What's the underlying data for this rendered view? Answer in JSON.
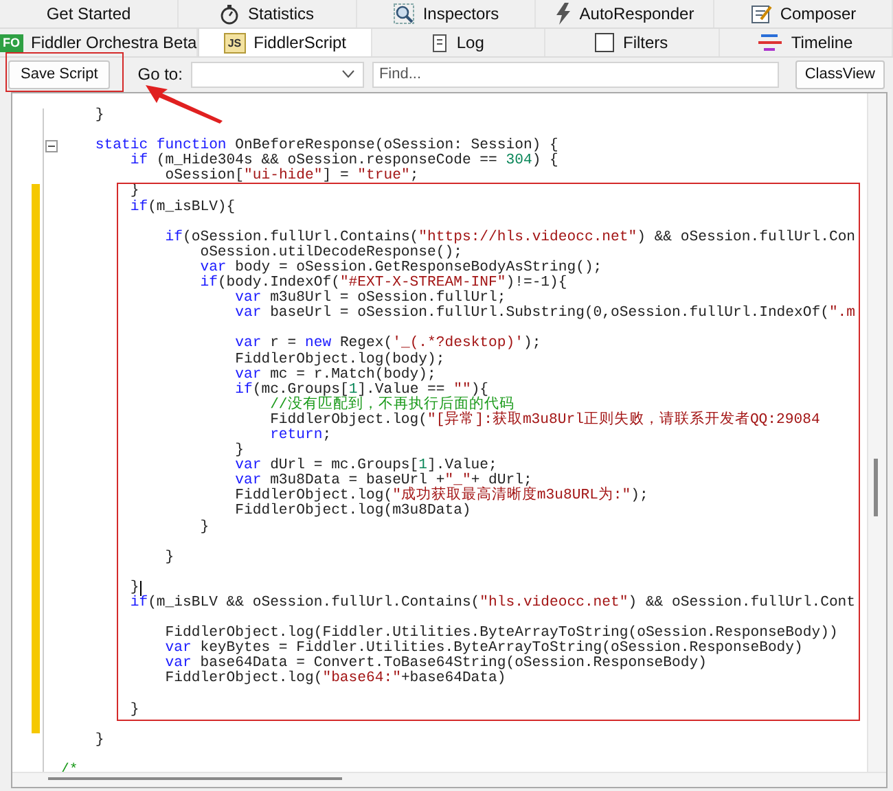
{
  "tabs": [
    [
      {
        "label": "Get Started",
        "selected": false
      },
      {
        "label": "Statistics",
        "selected": false
      },
      {
        "label": "Inspectors",
        "selected": false
      },
      {
        "label": "AutoResponder",
        "selected": false
      },
      {
        "label": "Composer",
        "selected": false
      }
    ],
    [
      {
        "label": "Fiddler Orchestra Beta",
        "badge": "FO",
        "selected": false
      },
      {
        "label": "FiddlerScript",
        "badge": "JS",
        "selected": true
      },
      {
        "label": "Log",
        "selected": false
      },
      {
        "label": "Filters",
        "selected": false
      },
      {
        "label": "Timeline",
        "selected": false
      }
    ]
  ],
  "toolbar": {
    "save_button": "Save Script",
    "goto_label": "Go to:",
    "find_field": {
      "placeholder": "Find..."
    },
    "classview_button": "ClassView"
  },
  "editor": {
    "lines": [
      {
        "changed": false,
        "fold": false,
        "caret": false,
        "parts": [
          {
            "kind": "plain",
            "text": "    }"
          }
        ]
      },
      {
        "changed": false,
        "fold": false,
        "caret": false
      },
      {
        "changed": false,
        "fold": true,
        "caret": false,
        "parts": [
          {
            "kind": "keyword",
            "text": "    static"
          },
          {
            "kind": "keyword",
            "text": " function"
          },
          {
            "kind": "plain",
            "text": " OnBeforeResponse(oSession: Session) {"
          }
        ]
      },
      {
        "changed": false,
        "fold": false,
        "caret": false,
        "parts": [
          {
            "kind": "keyword",
            "text": "        if"
          },
          {
            "kind": "plain",
            "text": " (m_Hide304s && oSession.responseCode == "
          },
          {
            "kind": "number",
            "text": "304"
          },
          {
            "kind": "plain",
            "text": ") {"
          }
        ]
      },
      {
        "changed": false,
        "fold": false,
        "caret": false,
        "parts": [
          {
            "kind": "plain",
            "text": "            oSession["
          },
          {
            "kind": "string",
            "text": "\"ui-hide\""
          },
          {
            "kind": "plain",
            "text": "] = "
          },
          {
            "kind": "string",
            "text": "\"true\""
          },
          {
            "kind": "plain",
            "text": ";"
          }
        ]
      },
      {
        "changed": true,
        "fold": false,
        "caret": false,
        "parts": [
          {
            "kind": "plain",
            "text": "        }"
          }
        ]
      },
      {
        "changed": true,
        "fold": false,
        "caret": false,
        "parts": [
          {
            "kind": "keyword",
            "text": "        if"
          },
          {
            "kind": "plain",
            "text": "(m_isBLV){"
          }
        ]
      },
      {
        "changed": true,
        "fold": false,
        "caret": false
      },
      {
        "changed": true,
        "fold": false,
        "caret": false,
        "parts": [
          {
            "kind": "keyword",
            "text": "            if"
          },
          {
            "kind": "plain",
            "text": "(oSession.fullUrl.Contains("
          },
          {
            "kind": "string",
            "text": "\"https://hls.videocc.net\""
          },
          {
            "kind": "plain",
            "text": ") && oSession.fullUrl.Con"
          }
        ]
      },
      {
        "changed": true,
        "fold": false,
        "caret": false,
        "parts": [
          {
            "kind": "plain",
            "text": "                oSession.utilDecodeResponse();"
          }
        ]
      },
      {
        "changed": true,
        "fold": false,
        "caret": false,
        "parts": [
          {
            "kind": "keyword",
            "text": "                var"
          },
          {
            "kind": "plain",
            "text": " body = oSession.GetResponseBodyAsString();"
          }
        ]
      },
      {
        "changed": true,
        "fold": false,
        "caret": false,
        "parts": [
          {
            "kind": "keyword",
            "text": "                if"
          },
          {
            "kind": "plain",
            "text": "(body.IndexOf("
          },
          {
            "kind": "string",
            "text": "\"#EXT-X-STREAM-INF\""
          },
          {
            "kind": "plain",
            "text": ")!=-1){"
          }
        ]
      },
      {
        "changed": true,
        "fold": false,
        "caret": false,
        "parts": [
          {
            "kind": "keyword",
            "text": "                    var"
          },
          {
            "kind": "plain",
            "text": " m3u8Url = oSession.fullUrl;"
          }
        ]
      },
      {
        "changed": true,
        "fold": false,
        "caret": false,
        "parts": [
          {
            "kind": "keyword",
            "text": "                    var"
          },
          {
            "kind": "plain",
            "text": " baseUrl = oSession.fullUrl.Substring(0,oSession.fullUrl.IndexOf("
          },
          {
            "kind": "string",
            "text": "\".m"
          }
        ]
      },
      {
        "changed": true,
        "fold": false,
        "caret": false
      },
      {
        "changed": true,
        "fold": false,
        "caret": false,
        "parts": [
          {
            "kind": "keyword",
            "text": "                    var"
          },
          {
            "kind": "plain",
            "text": " r = "
          },
          {
            "kind": "keyword",
            "text": "new"
          },
          {
            "kind": "plain",
            "text": " Regex("
          },
          {
            "kind": "string",
            "text": "'_(.*?desktop)'"
          },
          {
            "kind": "plain",
            "text": ");"
          }
        ]
      },
      {
        "changed": true,
        "fold": false,
        "caret": false,
        "parts": [
          {
            "kind": "plain",
            "text": "                    FiddlerObject.log(body);"
          }
        ]
      },
      {
        "changed": true,
        "fold": false,
        "caret": false,
        "parts": [
          {
            "kind": "keyword",
            "text": "                    var"
          },
          {
            "kind": "plain",
            "text": " mc = r.Match(body);"
          }
        ]
      },
      {
        "changed": true,
        "fold": false,
        "caret": false,
        "parts": [
          {
            "kind": "keyword",
            "text": "                    if"
          },
          {
            "kind": "plain",
            "text": "(mc.Groups["
          },
          {
            "kind": "number",
            "text": "1"
          },
          {
            "kind": "plain",
            "text": "].Value == "
          },
          {
            "kind": "string",
            "text": "\"\""
          },
          {
            "kind": "plain",
            "text": "){"
          }
        ]
      },
      {
        "changed": true,
        "fold": false,
        "caret": false,
        "parts": [
          {
            "kind": "comment",
            "text": "                        //没有匹配到，不再执行后面的代码"
          }
        ]
      },
      {
        "changed": true,
        "fold": false,
        "caret": false,
        "parts": [
          {
            "kind": "plain",
            "text": "                        FiddlerObject.log("
          },
          {
            "kind": "string",
            "text": "\"[异常]:获取m3u8Url正则失败，请联系开发者QQ:29084"
          }
        ]
      },
      {
        "changed": true,
        "fold": false,
        "caret": false,
        "parts": [
          {
            "kind": "keyword",
            "text": "                        return"
          },
          {
            "kind": "plain",
            "text": ";"
          }
        ]
      },
      {
        "changed": true,
        "fold": false,
        "caret": false,
        "parts": [
          {
            "kind": "plain",
            "text": "                    }"
          }
        ]
      },
      {
        "changed": true,
        "fold": false,
        "caret": false,
        "parts": [
          {
            "kind": "keyword",
            "text": "                    var"
          },
          {
            "kind": "plain",
            "text": " dUrl = mc.Groups["
          },
          {
            "kind": "number",
            "text": "1"
          },
          {
            "kind": "plain",
            "text": "].Value;"
          }
        ]
      },
      {
        "changed": true,
        "fold": false,
        "caret": false,
        "parts": [
          {
            "kind": "keyword",
            "text": "                    var"
          },
          {
            "kind": "plain",
            "text": " m3u8Data = baseUrl +"
          },
          {
            "kind": "string",
            "text": "\"_\""
          },
          {
            "kind": "plain",
            "text": "+ dUrl;"
          }
        ]
      },
      {
        "changed": true,
        "fold": false,
        "caret": false,
        "parts": [
          {
            "kind": "plain",
            "text": "                    FiddlerObject.log("
          },
          {
            "kind": "string",
            "text": "\"成功获取最高清晰度m3u8URL为:\""
          },
          {
            "kind": "plain",
            "text": ");"
          }
        ]
      },
      {
        "changed": true,
        "fold": false,
        "caret": false,
        "parts": [
          {
            "kind": "plain",
            "text": "                    FiddlerObject.log(m3u8Data)"
          }
        ]
      },
      {
        "changed": true,
        "fold": false,
        "caret": false,
        "parts": [
          {
            "kind": "plain",
            "text": "                }"
          }
        ]
      },
      {
        "changed": true,
        "fold": false,
        "caret": false
      },
      {
        "changed": true,
        "fold": false,
        "caret": false,
        "parts": [
          {
            "kind": "plain",
            "text": "            }"
          }
        ]
      },
      {
        "changed": true,
        "fold": false,
        "caret": false
      },
      {
        "changed": true,
        "fold": false,
        "caret": true,
        "parts": [
          {
            "kind": "plain",
            "text": "        }"
          }
        ]
      },
      {
        "changed": true,
        "fold": false,
        "caret": false,
        "parts": [
          {
            "kind": "keyword",
            "text": "        if"
          },
          {
            "kind": "plain",
            "text": "(m_isBLV && oSession.fullUrl.Contains("
          },
          {
            "kind": "string",
            "text": "\"hls.videocc.net\""
          },
          {
            "kind": "plain",
            "text": ") && oSession.fullUrl.Cont"
          }
        ]
      },
      {
        "changed": true,
        "fold": false,
        "caret": false
      },
      {
        "changed": true,
        "fold": false,
        "caret": false,
        "parts": [
          {
            "kind": "plain",
            "text": "            FiddlerObject.log(Fiddler.Utilities.ByteArrayToString(oSession.ResponseBody))"
          }
        ]
      },
      {
        "changed": true,
        "fold": false,
        "caret": false,
        "parts": [
          {
            "kind": "keyword",
            "text": "            var"
          },
          {
            "kind": "plain",
            "text": " keyBytes = Fiddler.Utilities.ByteArrayToString(oSession.ResponseBody)"
          }
        ]
      },
      {
        "changed": true,
        "fold": false,
        "caret": false,
        "parts": [
          {
            "kind": "keyword",
            "text": "            var"
          },
          {
            "kind": "plain",
            "text": " base64Data = Convert.ToBase64String(oSession.ResponseBody)"
          }
        ]
      },
      {
        "changed": true,
        "fold": false,
        "caret": false,
        "parts": [
          {
            "kind": "plain",
            "text": "            FiddlerObject.log("
          },
          {
            "kind": "string",
            "text": "\"base64:\""
          },
          {
            "kind": "plain",
            "text": "+base64Data)"
          }
        ]
      },
      {
        "changed": true,
        "fold": false,
        "caret": false
      },
      {
        "changed": true,
        "fold": false,
        "caret": false,
        "parts": [
          {
            "kind": "plain",
            "text": "        }"
          }
        ]
      },
      {
        "changed": true,
        "fold": false,
        "caret": false
      },
      {
        "changed": false,
        "fold": false,
        "caret": false,
        "parts": [
          {
            "kind": "plain",
            "text": "    }"
          }
        ]
      },
      {
        "changed": false,
        "fold": false,
        "caret": false
      },
      {
        "changed": false,
        "fold": false,
        "caret": false,
        "parts": [
          {
            "kind": "comment",
            "text": "/*"
          }
        ]
      }
    ]
  }
}
